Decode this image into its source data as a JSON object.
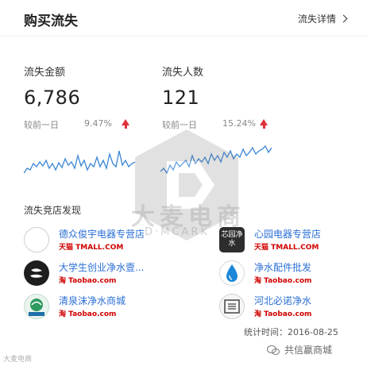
{
  "header": {
    "title": "购买流失",
    "detail_link": "流失详情"
  },
  "metrics": [
    {
      "label": "流失金额",
      "value": "6,786",
      "compare_label": "较前一日",
      "change": "9.47%",
      "trend": "up"
    },
    {
      "label": "流失人数",
      "value": "121",
      "compare_label": "较前一日",
      "change": "15.24%",
      "trend": "up"
    }
  ],
  "competitors": {
    "title": "流失竞店发现",
    "shops": [
      {
        "name": "德众俊宇电器专营店",
        "platform": "天猫 TMALL.COM",
        "logo_text": ""
      },
      {
        "name": "心园电器专营店",
        "platform": "天猫 TMALL.COM",
        "logo_text": "芯园净水"
      },
      {
        "name": "大学生创业净水壹...",
        "platform": "淘 Taobao.com",
        "logo_text": ""
      },
      {
        "name": "净水配件批发",
        "platform": "淘 Taobao.com",
        "logo_text": ""
      },
      {
        "name": "清泉沫净水商城",
        "platform": "淘 Taobao.com",
        "logo_text": "清泉沫"
      },
      {
        "name": "河北必诺净水",
        "platform": "淘 Taobao.com",
        "logo_text": "必诺"
      }
    ]
  },
  "stat_time": "统计时间：2016-08-25",
  "footer": {
    "left_text": "大麦电商",
    "right_text": "共信嬴商城"
  },
  "watermark": {
    "main": "大麦电商",
    "sub": "D·MCARK"
  },
  "colors": {
    "link": "#2a6fd6",
    "spark": "#3a86d6",
    "up_arrow": "#e0303a"
  }
}
